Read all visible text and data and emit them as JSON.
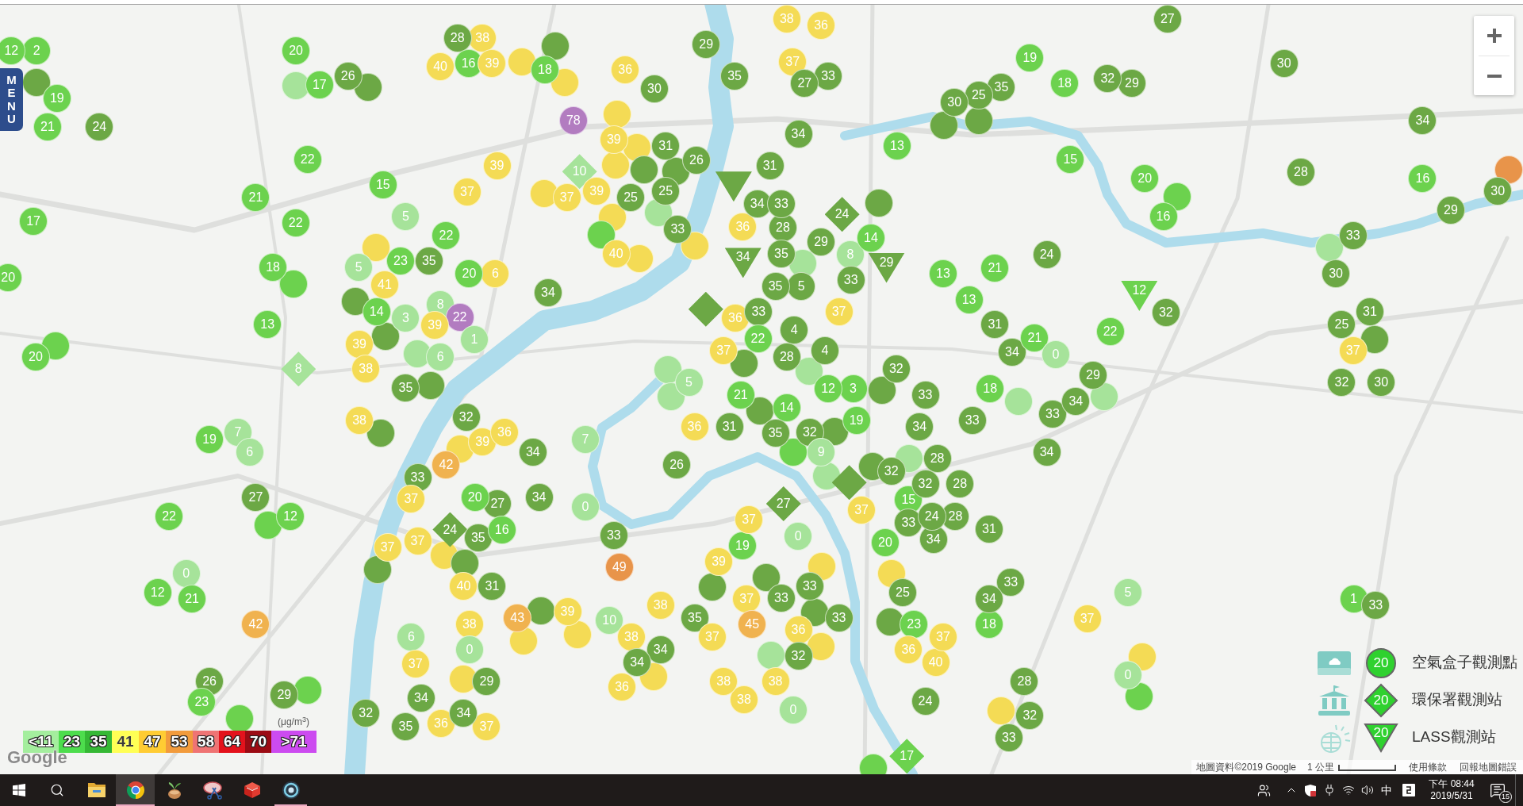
{
  "menu_button": "MENU",
  "markers": [
    {
      "kind": "airbox",
      "value": "12",
      "color": "#6cd24e"
    },
    {
      "kind": "airbox",
      "value": "2",
      "color": "#6cd24e"
    },
    {
      "kind": "airbox",
      "color": "#6ca845"
    },
    {
      "kind": "airbox",
      "value": "19",
      "color": "#6cd24e"
    },
    {
      "kind": "airbox",
      "value": "21",
      "color": "#6cd24e"
    },
    {
      "kind": "airbox",
      "value": "24",
      "color": "#6ca845"
    },
    {
      "kind": "airbox",
      "value": "17",
      "color": "#6cd24e"
    },
    {
      "kind": "airbox",
      "value": "20",
      "color": "#6cd24e"
    },
    {
      "kind": "airbox",
      "value": "20",
      "color": "#6cd24e"
    },
    {
      "kind": "airbox",
      "color": "#a6e39a"
    },
    {
      "kind": "airbox",
      "value": "20",
      "color": "#6cd24e"
    },
    {
      "kind": "airbox",
      "color": "#6cd24e"
    },
    {
      "kind": "airbox",
      "value": "17",
      "color": "#6cd24e"
    },
    {
      "kind": "airbox",
      "value": "26",
      "color": "#6ca845"
    },
    {
      "kind": "airbox",
      "value": "21",
      "color": "#6cd24e"
    },
    {
      "kind": "airbox",
      "color": "#6ca845"
    },
    {
      "kind": "airbox",
      "value": "22",
      "color": "#6cd24e"
    },
    {
      "kind": "airbox",
      "value": "28",
      "color": "#6ca845"
    },
    {
      "kind": "airbox",
      "value": "40",
      "color": "#f4db55"
    },
    {
      "kind": "airbox",
      "value": "22",
      "color": "#6cd24e"
    },
    {
      "kind": "airbox",
      "value": "38",
      "color": "#f4db55"
    },
    {
      "kind": "airbox",
      "value": "16",
      "color": "#6cd24e"
    },
    {
      "kind": "airbox",
      "value": "18",
      "color": "#6cd24e"
    },
    {
      "kind": "airbox",
      "value": "39",
      "color": "#f4db55"
    },
    {
      "kind": "airbox",
      "value": "15",
      "color": "#6cd24e"
    },
    {
      "kind": "airbox",
      "color": "#6cd24e"
    },
    {
      "kind": "airbox",
      "color": "#f4db55"
    },
    {
      "kind": "airbox",
      "value": "13",
      "color": "#6cd24e"
    },
    {
      "kind": "airbox",
      "color": "#6ca845"
    },
    {
      "kind": "airbox",
      "value": "18",
      "color": "#6cd24e"
    },
    {
      "kind": "airbox",
      "value": "5",
      "color": "#a6e39a"
    },
    {
      "kind": "airbox",
      "color": "#f4db55"
    },
    {
      "kind": "airbox",
      "value": "5",
      "color": "#a6e39a"
    },
    {
      "kind": "airbox",
      "color": "#f4db55"
    },
    {
      "kind": "airbox",
      "value": "19",
      "color": "#6cd24e"
    },
    {
      "kind": "airbox",
      "color": "#6ca845"
    },
    {
      "kind": "airbox",
      "value": "37",
      "color": "#f4db55"
    },
    {
      "kind": "airbox",
      "value": "23",
      "color": "#6cd24e"
    },
    {
      "kind": "airbox",
      "value": "39",
      "color": "#f4db55"
    },
    {
      "kind": "epa",
      "value": "8",
      "color": "#a6e39a"
    },
    {
      "kind": "airbox",
      "value": "41",
      "color": "#f4db55"
    },
    {
      "kind": "airbox",
      "value": "7",
      "color": "#a6e39a"
    },
    {
      "kind": "airbox",
      "value": "22",
      "color": "#6cd24e"
    },
    {
      "kind": "airbox",
      "value": "22",
      "color": "#6cd24e"
    },
    {
      "kind": "airbox",
      "value": "14",
      "color": "#6cd24e"
    },
    {
      "kind": "airbox",
      "value": "35",
      "color": "#6ca845"
    },
    {
      "kind": "airbox",
      "value": "78",
      "color": "#b27cc0"
    },
    {
      "kind": "airbox",
      "value": "36",
      "color": "#f4db55"
    },
    {
      "kind": "airbox",
      "value": "6",
      "color": "#a6e39a"
    },
    {
      "kind": "airbox",
      "value": "39",
      "color": "#f4db55"
    },
    {
      "kind": "airbox",
      "color": "#6ca845"
    },
    {
      "kind": "airbox",
      "value": "3",
      "color": "#a6e39a"
    },
    {
      "kind": "airbox",
      "color": "#f4db55"
    },
    {
      "kind": "airbox",
      "value": "38",
      "color": "#f4db55"
    },
    {
      "kind": "airbox",
      "color": "#f4db55"
    },
    {
      "kind": "airbox",
      "value": "20",
      "color": "#6cd24e"
    },
    {
      "kind": "airbox",
      "value": "30",
      "color": "#6ca845"
    },
    {
      "kind": "airbox",
      "value": "8",
      "color": "#a6e39a"
    },
    {
      "kind": "airbox",
      "value": "29",
      "color": "#6ca845"
    },
    {
      "kind": "airbox",
      "value": "12",
      "color": "#6cd24e"
    },
    {
      "kind": "epa",
      "value": "10",
      "color": "#a6e39a"
    },
    {
      "kind": "airbox",
      "value": "27",
      "color": "#6ca845"
    },
    {
      "kind": "airbox",
      "value": "39",
      "color": "#f4db55"
    },
    {
      "kind": "airbox",
      "value": "39",
      "color": "#f4db55"
    },
    {
      "kind": "airbox",
      "value": "0",
      "color": "#a6e39a"
    },
    {
      "kind": "airbox",
      "value": "37",
      "color": "#f4db55"
    },
    {
      "kind": "airbox",
      "value": "6",
      "color": "#f4db55"
    },
    {
      "kind": "airbox",
      "color": "#a6e39a"
    },
    {
      "kind": "airbox",
      "value": "22",
      "color": "#b27cc0"
    },
    {
      "kind": "airbox",
      "value": "38",
      "color": "#f4db55"
    },
    {
      "kind": "airbox",
      "color": "#f4db55"
    },
    {
      "kind": "airbox",
      "color": "#f4db55"
    },
    {
      "kind": "airbox",
      "value": "39",
      "color": "#f4db55"
    },
    {
      "kind": "airbox",
      "value": "21",
      "color": "#6cd24e"
    },
    {
      "kind": "airbox",
      "value": "35",
      "color": "#6ca845"
    },
    {
      "kind": "airbox",
      "color": "#6cd24e"
    },
    {
      "kind": "airbox",
      "value": "6",
      "color": "#a6e39a"
    },
    {
      "kind": "airbox",
      "value": "38",
      "color": "#f4db55"
    },
    {
      "kind": "airbox",
      "value": "12",
      "color": "#6cd24e"
    },
    {
      "kind": "airbox",
      "value": "35",
      "color": "#6ca845"
    },
    {
      "kind": "airbox",
      "value": "31",
      "color": "#6ca845"
    },
    {
      "kind": "airbox",
      "value": "1",
      "color": "#a6e39a"
    },
    {
      "kind": "airbox",
      "color": "#6ca845"
    },
    {
      "kind": "airbox",
      "color": "#6ca845"
    },
    {
      "kind": "airbox",
      "color": "#6ca845"
    },
    {
      "kind": "airbox",
      "value": "25",
      "color": "#6ca845"
    },
    {
      "kind": "airbox",
      "color": "#f4db55"
    },
    {
      "kind": "airbox",
      "color": "#6cd24e"
    },
    {
      "kind": "airbox",
      "value": "34",
      "color": "#6ca845"
    },
    {
      "kind": "airbox",
      "value": "36",
      "color": "#f4db55"
    },
    {
      "kind": "airbox",
      "color": "#6ca845"
    },
    {
      "kind": "airbox",
      "value": "37",
      "color": "#f4db55"
    },
    {
      "kind": "airbox",
      "value": "26",
      "color": "#6ca845"
    },
    {
      "kind": "airbox",
      "value": "25",
      "color": "#6ca845"
    },
    {
      "kind": "airbox",
      "value": "40",
      "color": "#f4db55"
    },
    {
      "kind": "airbox",
      "color": "#a6e39a"
    },
    {
      "kind": "airbox",
      "value": "42",
      "color": "#f0b24f"
    },
    {
      "kind": "airbox",
      "value": "32",
      "color": "#6ca845"
    },
    {
      "kind": "airbox",
      "value": "27",
      "color": "#6ca845"
    },
    {
      "kind": "airbox",
      "value": "26",
      "color": "#6ca845"
    },
    {
      "kind": "airbox",
      "value": "33",
      "color": "#6ca845"
    },
    {
      "kind": "airbox",
      "color": "#f4db55"
    },
    {
      "kind": "airbox",
      "value": "23",
      "color": "#6cd24e"
    },
    {
      "kind": "airbox",
      "value": "33",
      "color": "#6ca845"
    },
    {
      "kind": "airbox",
      "value": "33",
      "color": "#6ca845"
    },
    {
      "kind": "airbox",
      "color": "#f4db55"
    },
    {
      "kind": "airbox",
      "value": "37",
      "color": "#f4db55"
    },
    {
      "kind": "airbox",
      "value": "42",
      "color": "#f0b24f"
    },
    {
      "kind": "lass",
      "color": "#6ca845"
    },
    {
      "kind": "airbox",
      "value": "39",
      "color": "#f4db55"
    },
    {
      "kind": "airbox",
      "value": "34",
      "color": "#6ca845"
    },
    {
      "kind": "airbox",
      "value": "37",
      "color": "#f4db55"
    },
    {
      "kind": "airbox",
      "value": "31",
      "color": "#6ca845"
    },
    {
      "kind": "airbox",
      "value": "36",
      "color": "#f4db55"
    },
    {
      "kind": "airbox",
      "color": "#f4db55"
    },
    {
      "kind": "airbox",
      "color": "#6ca845"
    },
    {
      "kind": "airbox",
      "color": "#6cd24e"
    },
    {
      "kind": "airbox",
      "value": "37",
      "color": "#f4db55"
    },
    {
      "kind": "airbox",
      "value": "34",
      "color": "#6ca845"
    },
    {
      "kind": "airbox",
      "value": "36",
      "color": "#f4db55"
    },
    {
      "kind": "airbox",
      "value": "20",
      "color": "#6cd24e"
    },
    {
      "kind": "airbox",
      "value": "29",
      "color": "#6ca845"
    },
    {
      "kind": "epa",
      "value": "24",
      "color": "#6ca845"
    },
    {
      "kind": "airbox",
      "value": "33",
      "color": "#6ca845"
    },
    {
      "kind": "airbox",
      "value": "34",
      "color": "#6ca845"
    },
    {
      "kind": "airbox",
      "color": "#6cd24e"
    },
    {
      "kind": "airbox",
      "color": "#f4db55"
    },
    {
      "kind": "lass",
      "value": "34",
      "color": "#6ca845"
    },
    {
      "kind": "airbox",
      "value": "27",
      "color": "#6ca845"
    },
    {
      "kind": "airbox",
      "value": "28",
      "color": "#6ca845"
    },
    {
      "kind": "epa",
      "color": "#6ca845"
    },
    {
      "kind": "airbox",
      "value": "35",
      "color": "#6ca845"
    },
    {
      "kind": "airbox",
      "value": "7",
      "color": "#a6e39a"
    },
    {
      "kind": "airbox",
      "color": "#6ca845"
    },
    {
      "kind": "airbox",
      "value": "16",
      "color": "#6cd24e"
    },
    {
      "kind": "airbox",
      "value": "35",
      "color": "#6ca845"
    },
    {
      "kind": "airbox",
      "value": "34",
      "color": "#6ca845"
    },
    {
      "kind": "airbox",
      "color": "#a6e39a"
    },
    {
      "kind": "airbox",
      "value": "13",
      "color": "#6cd24e"
    },
    {
      "kind": "airbox",
      "value": "6",
      "color": "#a6e39a"
    },
    {
      "kind": "airbox",
      "value": "40",
      "color": "#f4db55"
    },
    {
      "kind": "airbox",
      "value": "36",
      "color": "#f4db55"
    },
    {
      "kind": "airbox",
      "value": "30",
      "color": "#6ca845"
    },
    {
      "kind": "epa",
      "value": "24",
      "color": "#6ca845"
    },
    {
      "kind": "airbox",
      "value": "35",
      "color": "#6ca845"
    },
    {
      "kind": "airbox",
      "value": "29",
      "color": "#6ca845"
    },
    {
      "kind": "airbox",
      "color": "#6ca845"
    },
    {
      "kind": "airbox",
      "color": "#a6e39a"
    },
    {
      "kind": "airbox",
      "color": "#a6e39a"
    },
    {
      "kind": "airbox",
      "color": "#6ca845"
    },
    {
      "kind": "airbox",
      "value": "33",
      "color": "#6ca845"
    },
    {
      "kind": "airbox",
      "value": "5",
      "color": "#a6e39a"
    },
    {
      "kind": "airbox",
      "value": "25",
      "color": "#6ca845"
    },
    {
      "kind": "airbox",
      "value": "37",
      "color": "#f4db55"
    },
    {
      "kind": "airbox",
      "value": "31",
      "color": "#6ca845"
    },
    {
      "kind": "airbox",
      "value": "32",
      "color": "#6ca845"
    },
    {
      "kind": "airbox",
      "value": "37",
      "color": "#f4db55"
    },
    {
      "kind": "airbox",
      "value": "5",
      "color": "#6ca845"
    },
    {
      "kind": "airbox",
      "value": "19",
      "color": "#6cd24e"
    },
    {
      "kind": "airbox",
      "value": "35",
      "color": "#6ca845"
    },
    {
      "kind": "airbox",
      "value": "0",
      "color": "#a6e39a"
    },
    {
      "kind": "airbox",
      "value": "38",
      "color": "#f4db55"
    },
    {
      "kind": "airbox",
      "value": "22",
      "color": "#6cd24e"
    },
    {
      "kind": "airbox",
      "color": "#6ca845"
    },
    {
      "kind": "airbox",
      "value": "8",
      "color": "#a6e39a"
    },
    {
      "kind": "airbox",
      "color": "#6ca845"
    },
    {
      "kind": "airbox",
      "value": "14",
      "color": "#6cd24e"
    },
    {
      "kind": "airbox",
      "value": "0",
      "color": "#a6e39a"
    },
    {
      "kind": "airbox",
      "value": "34",
      "color": "#6ca845"
    },
    {
      "kind": "airbox",
      "value": "36",
      "color": "#f4db55"
    },
    {
      "kind": "airbox",
      "value": "4",
      "color": "#6ca845"
    },
    {
      "kind": "airbox",
      "value": "33",
      "color": "#6ca845"
    },
    {
      "kind": "airbox",
      "value": "35",
      "color": "#6ca845"
    },
    {
      "kind": "airbox",
      "value": "43",
      "color": "#f0b24f"
    },
    {
      "kind": "airbox",
      "value": "21",
      "color": "#6cd24e"
    },
    {
      "kind": "airbox",
      "value": "26",
      "color": "#6ca845"
    },
    {
      "kind": "airbox",
      "color": "#f4db55"
    },
    {
      "kind": "airbox",
      "value": "28",
      "color": "#6ca845"
    },
    {
      "kind": "airbox",
      "value": "18",
      "color": "#6cd24e"
    },
    {
      "kind": "lass",
      "value": "29",
      "color": "#6ca845"
    },
    {
      "kind": "airbox",
      "value": "33",
      "color": "#6ca845"
    },
    {
      "kind": "airbox",
      "value": "37",
      "color": "#f4db55"
    },
    {
      "kind": "airbox",
      "color": "#6ca845"
    },
    {
      "kind": "airbox",
      "value": "31",
      "color": "#6ca845"
    },
    {
      "kind": "airbox",
      "value": "36",
      "color": "#f4db55"
    },
    {
      "kind": "airbox",
      "color": "#f4db55"
    },
    {
      "kind": "airbox",
      "value": "29",
      "color": "#6ca845"
    },
    {
      "kind": "airbox",
      "color": "#6ca845"
    },
    {
      "kind": "airbox",
      "value": "4",
      "color": "#6ca845"
    },
    {
      "kind": "airbox",
      "value": "34",
      "color": "#6ca845"
    },
    {
      "kind": "airbox",
      "value": "39",
      "color": "#f4db55"
    },
    {
      "kind": "airbox",
      "color": "#a6e39a"
    },
    {
      "kind": "airbox",
      "value": "32",
      "color": "#6ca845"
    },
    {
      "kind": "airbox",
      "value": "27",
      "color": "#6ca845"
    },
    {
      "kind": "airbox",
      "value": "49",
      "color": "#e8944a"
    },
    {
      "kind": "airbox",
      "value": "14",
      "color": "#6cd24e"
    },
    {
      "kind": "airbox",
      "value": "35",
      "color": "#6ca845"
    },
    {
      "kind": "airbox",
      "color": "#f4db55"
    },
    {
      "kind": "airbox",
      "value": "37",
      "color": "#f4db55"
    },
    {
      "kind": "airbox",
      "value": "29",
      "color": "#6ca845"
    },
    {
      "kind": "airbox",
      "value": "13",
      "color": "#6cd24e"
    },
    {
      "kind": "airbox",
      "value": "12",
      "color": "#6cd24e"
    },
    {
      "kind": "airbox",
      "value": "15",
      "color": "#6cd24e"
    },
    {
      "kind": "airbox",
      "value": "10",
      "color": "#a6e39a"
    },
    {
      "kind": "airbox",
      "value": "3",
      "color": "#6cd24e"
    },
    {
      "kind": "airbox",
      "value": "32",
      "color": "#6ca845"
    },
    {
      "kind": "airbox",
      "color": "#6cd24e"
    },
    {
      "kind": "airbox",
      "value": "21",
      "color": "#6cd24e"
    },
    {
      "kind": "airbox",
      "value": "32",
      "color": "#6ca845"
    },
    {
      "kind": "airbox",
      "color": "#6ca845"
    },
    {
      "kind": "airbox",
      "value": "38",
      "color": "#f4db55"
    },
    {
      "kind": "airbox",
      "value": "37",
      "color": "#f4db55"
    },
    {
      "kind": "airbox",
      "value": "38",
      "color": "#f4db55"
    },
    {
      "kind": "airbox",
      "value": "13",
      "color": "#6cd24e"
    },
    {
      "kind": "airbox",
      "color": "#6ca845"
    },
    {
      "kind": "airbox",
      "value": "9",
      "color": "#a6e39a"
    },
    {
      "kind": "airbox",
      "value": "19",
      "color": "#6cd24e"
    },
    {
      "kind": "airbox",
      "value": "39",
      "color": "#f4db55"
    },
    {
      "kind": "epa",
      "value": "27",
      "color": "#6ca845"
    },
    {
      "kind": "airbox",
      "value": "19",
      "color": "#6cd24e"
    },
    {
      "kind": "airbox",
      "color": "#6ca845"
    },
    {
      "kind": "airbox",
      "value": "34",
      "color": "#6ca845"
    },
    {
      "kind": "airbox",
      "value": "24",
      "color": "#6ca845"
    },
    {
      "kind": "airbox",
      "color": "#a6e39a"
    },
    {
      "kind": "airbox",
      "value": "36",
      "color": "#f4db55"
    },
    {
      "kind": "airbox",
      "value": "34",
      "color": "#6ca845"
    },
    {
      "kind": "airbox",
      "value": "35",
      "color": "#6ca845"
    },
    {
      "kind": "airbox",
      "value": "31",
      "color": "#6ca845"
    },
    {
      "kind": "airbox",
      "value": "33",
      "color": "#6ca845"
    },
    {
      "kind": "airbox",
      "value": "20",
      "color": "#6cd24e"
    },
    {
      "kind": "airbox",
      "color": "#f4db55"
    },
    {
      "kind": "epa",
      "color": "#6ca845"
    },
    {
      "kind": "airbox",
      "value": "0",
      "color": "#a6e39a"
    },
    {
      "kind": "airbox",
      "color": "#6ca845"
    },
    {
      "kind": "airbox",
      "color": "#6ca845"
    },
    {
      "kind": "airbox",
      "value": "37",
      "color": "#f4db55"
    },
    {
      "kind": "airbox",
      "value": "34",
      "color": "#6ca845"
    },
    {
      "kind": "airbox",
      "value": "30",
      "color": "#6ca845"
    },
    {
      "kind": "airbox",
      "value": "37",
      "color": "#f4db55"
    },
    {
      "kind": "airbox",
      "value": "32",
      "color": "#6ca845"
    },
    {
      "kind": "airbox",
      "value": "34",
      "color": "#6ca845"
    },
    {
      "kind": "airbox",
      "color": "#a6e39a"
    },
    {
      "kind": "airbox",
      "value": "37",
      "color": "#f4db55"
    },
    {
      "kind": "airbox",
      "value": "21",
      "color": "#6cd24e"
    },
    {
      "kind": "airbox",
      "color": "#6cd24e"
    },
    {
      "kind": "airbox",
      "value": "45",
      "color": "#f0b24f"
    },
    {
      "kind": "airbox",
      "value": "18",
      "color": "#6cd24e"
    },
    {
      "kind": "airbox",
      "value": "33",
      "color": "#6ca845"
    },
    {
      "kind": "airbox",
      "value": "16",
      "color": "#6cd24e"
    },
    {
      "kind": "airbox",
      "color": "#f4db55"
    },
    {
      "kind": "airbox",
      "value": "33",
      "color": "#6ca845"
    },
    {
      "kind": "airbox",
      "value": "28",
      "color": "#6ca845"
    },
    {
      "kind": "airbox",
      "value": "33",
      "color": "#6ca845"
    },
    {
      "kind": "airbox",
      "value": "38",
      "color": "#f4db55"
    },
    {
      "kind": "airbox",
      "value": "15",
      "color": "#6cd24e"
    },
    {
      "kind": "airbox",
      "value": "32",
      "color": "#6ca845"
    },
    {
      "kind": "airbox",
      "value": "0",
      "color": "#a6e39a"
    },
    {
      "kind": "airbox",
      "color": "#a6e39a"
    },
    {
      "kind": "airbox",
      "color": "#a6e39a"
    },
    {
      "kind": "airbox",
      "color": "#6ca845"
    },
    {
      "kind": "airbox",
      "value": "20",
      "color": "#6cd24e"
    },
    {
      "kind": "airbox",
      "value": "36",
      "color": "#f4db55"
    },
    {
      "kind": "lass",
      "value": "12",
      "color": "#6cd24e"
    },
    {
      "kind": "airbox",
      "value": "33",
      "color": "#6ca845"
    },
    {
      "kind": "airbox",
      "value": "22",
      "color": "#6cd24e"
    },
    {
      "kind": "airbox",
      "value": "28",
      "color": "#6ca845"
    },
    {
      "kind": "airbox",
      "value": "38",
      "color": "#f4db55"
    },
    {
      "kind": "airbox",
      "value": "24",
      "color": "#6ca845"
    },
    {
      "kind": "airbox",
      "value": "32",
      "color": "#6ca845"
    },
    {
      "kind": "airbox",
      "value": "33",
      "color": "#6ca845"
    },
    {
      "kind": "airbox",
      "value": "38",
      "color": "#f4db55"
    },
    {
      "kind": "airbox",
      "color": "#f4db55"
    },
    {
      "kind": "airbox",
      "value": "33",
      "color": "#6ca845"
    },
    {
      "kind": "airbox",
      "color": "#f4db55"
    },
    {
      "kind": "airbox",
      "value": "29",
      "color": "#6ca845"
    },
    {
      "kind": "airbox",
      "value": "28",
      "color": "#6ca845"
    },
    {
      "kind": "airbox",
      "value": "28",
      "color": "#6ca845"
    },
    {
      "kind": "airbox",
      "value": "34",
      "color": "#6ca845"
    },
    {
      "kind": "airbox",
      "value": "34",
      "color": "#6ca845"
    },
    {
      "kind": "airbox",
      "value": "32",
      "color": "#6ca845"
    },
    {
      "kind": "airbox",
      "value": "25",
      "color": "#6ca845"
    },
    {
      "kind": "airbox",
      "value": "34",
      "color": "#6ca845"
    },
    {
      "kind": "airbox",
      "color": "#a6e39a"
    },
    {
      "kind": "airbox",
      "value": "0",
      "color": "#a6e39a"
    },
    {
      "kind": "airbox",
      "color": "#6ca845"
    },
    {
      "kind": "airbox",
      "value": "31",
      "color": "#6ca845"
    },
    {
      "kind": "airbox",
      "value": "23",
      "color": "#6cd24e"
    },
    {
      "kind": "airbox",
      "value": "34",
      "color": "#6ca845"
    },
    {
      "kind": "airbox",
      "value": "36",
      "color": "#f4db55"
    },
    {
      "kind": "airbox",
      "color": "#a6e39a"
    },
    {
      "kind": "airbox",
      "value": "37",
      "color": "#f4db55"
    },
    {
      "kind": "airbox",
      "value": "34",
      "color": "#6ca845"
    },
    {
      "kind": "airbox",
      "value": "33",
      "color": "#6ca845"
    },
    {
      "kind": "airbox",
      "value": "33",
      "color": "#6ca845"
    },
    {
      "kind": "airbox",
      "value": "40",
      "color": "#f4db55"
    },
    {
      "kind": "airbox",
      "value": "16",
      "color": "#6cd24e"
    },
    {
      "kind": "airbox",
      "value": "30",
      "color": "#6ca845"
    },
    {
      "kind": "airbox",
      "value": "18",
      "color": "#6cd24e"
    },
    {
      "kind": "airbox",
      "value": "24",
      "color": "#6ca845"
    },
    {
      "kind": "airbox",
      "color": "#6cd24e"
    },
    {
      "kind": "airbox",
      "value": "29",
      "color": "#6ca845"
    },
    {
      "kind": "epa",
      "value": "17",
      "color": "#6cd24e"
    },
    {
      "kind": "airbox",
      "value": "25",
      "color": "#6ca845"
    },
    {
      "kind": "airbox",
      "color": "#e8944a"
    },
    {
      "kind": "airbox",
      "value": "31",
      "color": "#6ca845"
    },
    {
      "kind": "airbox",
      "value": "30",
      "color": "#6ca845"
    },
    {
      "kind": "airbox",
      "value": "37",
      "color": "#f4db55"
    },
    {
      "kind": "airbox",
      "value": "28",
      "color": "#6ca845"
    },
    {
      "kind": "airbox",
      "value": "37",
      "color": "#f4db55"
    },
    {
      "kind": "airbox",
      "color": "#f4db55"
    },
    {
      "kind": "airbox",
      "color": "#6ca845"
    },
    {
      "kind": "airbox",
      "value": "5",
      "color": "#a6e39a"
    },
    {
      "kind": "airbox",
      "value": "32",
      "color": "#6ca845"
    },
    {
      "kind": "airbox",
      "value": "32",
      "color": "#6ca845"
    },
    {
      "kind": "airbox",
      "value": "33",
      "color": "#6ca845"
    },
    {
      "kind": "airbox",
      "value": "30",
      "color": "#6ca845"
    },
    {
      "kind": "airbox",
      "color": "#f4db55"
    },
    {
      "kind": "airbox",
      "value": "0",
      "color": "#a6e39a"
    },
    {
      "kind": "airbox",
      "color": "#6cd24e"
    },
    {
      "kind": "airbox",
      "value": "1",
      "color": "#6cd24e"
    },
    {
      "kind": "airbox",
      "value": "33",
      "color": "#6ca845"
    }
  ],
  "legend": {
    "unit": "(μg/m$^{3}$)",
    "levels": [
      {
        "label": "<11",
        "color": "#a4ee9e"
      },
      {
        "label": "23",
        "color": "#4ddd4d"
      },
      {
        "label": "35",
        "color": "#35b835"
      },
      {
        "label": "41",
        "color": "#ffff55"
      },
      {
        "label": "47",
        "color": "#ffcc33"
      },
      {
        "label": "53",
        "color": "#f29b3c"
      },
      {
        "label": "58",
        "color": "#ef7474"
      },
      {
        "label": "64",
        "color": "#e3121c"
      },
      {
        "label": "70",
        "color": "#9b0b14"
      },
      {
        "label": ">71",
        "color": "#cc4bf0"
      }
    ]
  },
  "logo": "Google",
  "station_legend": [
    {
      "kind": "airbox",
      "sample": "20",
      "label": "空氣盒子觀測點"
    },
    {
      "kind": "epa",
      "sample": "20",
      "label": "環保署觀測站"
    },
    {
      "kind": "lass",
      "sample": "20",
      "label": "LASS觀測站"
    }
  ],
  "attribution": {
    "data": "地圖資料©2019 Google",
    "scale": "1 公里",
    "terms": "使用條款",
    "report": "回報地圖錯誤"
  },
  "taskbar": {
    "apps": [
      {
        "kind": "folder",
        "running": false,
        "selected": false
      },
      {
        "kind": "browser",
        "running": true,
        "selected": true
      },
      {
        "kind": "plant",
        "running": false,
        "selected": false
      },
      {
        "kind": "scissors",
        "running": false,
        "selected": false
      },
      {
        "kind": "cube",
        "running": false,
        "selected": false
      },
      {
        "kind": "ring",
        "running": true,
        "selected": false
      }
    ],
    "tray": {
      "ime": "中",
      "time": "下午 08:44",
      "date": "2019/5/31",
      "notifications": "15"
    }
  }
}
